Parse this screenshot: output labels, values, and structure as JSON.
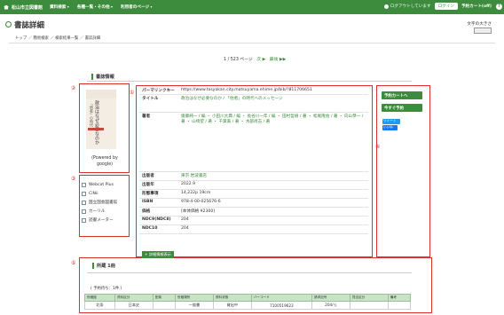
{
  "nav": {
    "brand": "松山市立図書館",
    "menu": [
      "資料検索",
      "各種一覧・その他",
      "利用者のページ"
    ],
    "logout_status": "ログアウトしています",
    "login_button": "ログイン",
    "cart": "予約カート(off)",
    "help": "?"
  },
  "page": {
    "title": "書誌詳細",
    "font_size_label": "文字の大きさ",
    "breadcrumb": "トップ ／ 簡易検索 ／ 検索結果一覧 ／ 書誌詳細"
  },
  "pager": {
    "current": "1",
    "total": "/ 523 ページ",
    "next": "次 ▶",
    "last": "最後 ▶▶"
  },
  "section_title": "書誌情報",
  "annotations": [
    "①",
    "②",
    "③",
    "④",
    "⑤"
  ],
  "cover": {
    "title": "政治はなぜ必要なのか",
    "subtitle": "「他者」の時代へ",
    "powered_line1": "(Powered by",
    "powered_line2": "google)"
  },
  "external_links": [
    {
      "label": "Webcat Plus",
      "icon": "webcat-icon"
    },
    {
      "label": "CiNii",
      "icon": "cinii-icon"
    },
    {
      "label": "国立国会図書館",
      "icon": "ndl-icon"
    },
    {
      "label": "カーリル",
      "icon": "calil-icon"
    },
    {
      "label": "読書メーター",
      "icon": "bookmeter-icon"
    }
  ],
  "bib": [
    {
      "k": "パーマリンクキー",
      "v": "https://www.tosyokan.city.matsuyama.ehime.jp/bib/?811706651"
    },
    {
      "k": "タイトル",
      "v": "政治はなぜ必要なのか / 「他者」の時代へのメッセージ",
      "green": true
    },
    {
      "k": "著者",
      "v": "齋藤純一 / 編 ・ 小田川大典 / 編 ・ 長谷川一年 / 編 ・ 田村哲樹 / 著 ・ 松尾隆佑 / 著 ・ 向山恭一 / 著 ・ 山崎望 / 著 ・ 千葉眞 / 著 ・ 木部尚志 / 著",
      "green": true
    },
    {
      "k": "出版者",
      "v": "東京 岩波書店",
      "green": true
    },
    {
      "k": "出版年",
      "v": "2022.9"
    },
    {
      "k": "形態事項",
      "v": "14,222p 19cm"
    },
    {
      "k": "ISBN",
      "v": "978-4-00-025676-6"
    },
    {
      "k": "価格",
      "v": "[本体価格 ¥2300]"
    },
    {
      "k": "NDC9(NDC8)",
      "v": "204"
    },
    {
      "k": "NDC10",
      "v": "204"
    }
  ],
  "add_link": "+ 詳細情報表示",
  "actions": {
    "cart": "予約カートへ",
    "quick": "今すぐ予約",
    "tweet": "ツイート",
    "like": "いいね"
  },
  "holdings": {
    "title": "所蔵 1冊",
    "reserve_count": "( 予約待ち：1件 )",
    "headers": [
      "所蔵館",
      "資料区分",
      "配架",
      "所蔵場所",
      "資料状態",
      "バーコード",
      "請求記号",
      "貸出区分",
      "備考"
    ],
    "row": [
      "北条",
      "日本史",
      "",
      "一般書",
      "貸出中",
      "7100519623",
      "204/ら",
      "",
      ""
    ]
  }
}
